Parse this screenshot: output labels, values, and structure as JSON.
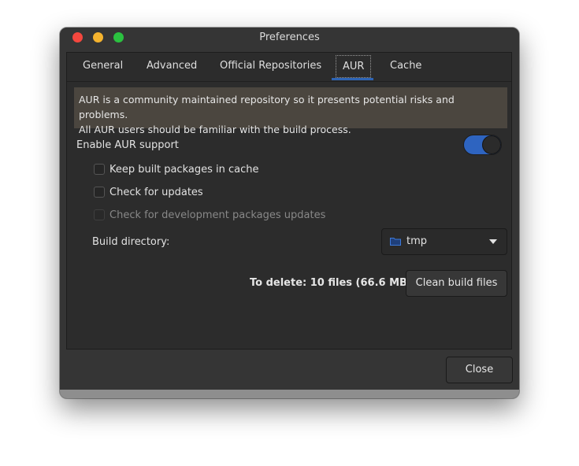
{
  "window": {
    "title": "Preferences"
  },
  "tabs": [
    {
      "label": "General"
    },
    {
      "label": "Advanced"
    },
    {
      "label": "Official Repositories"
    },
    {
      "label": "AUR"
    },
    {
      "label": "Cache"
    }
  ],
  "active_tab": "AUR",
  "notice": {
    "line1": "AUR is a community maintained repository so it presents potential risks and problems.",
    "line2": "All AUR users should be familiar with the build process."
  },
  "aur": {
    "enable_label": "Enable AUR support",
    "enabled": true,
    "checkboxes": [
      {
        "label": "Keep built packages in cache",
        "checked": false,
        "disabled": false
      },
      {
        "label": "Check for updates",
        "checked": false,
        "disabled": false
      },
      {
        "label": "Check for development packages updates",
        "checked": false,
        "disabled": true
      }
    ],
    "build_directory_label": "Build directory:",
    "build_directory_value": "tmp",
    "to_delete_text": "To delete:  10 files  (66.6 MB)",
    "clean_button": "Clean build files"
  },
  "footer": {
    "close_button": "Close"
  },
  "colors": {
    "accent": "#2e64c0",
    "notice_bg": "#4b463f",
    "window_bg": "#353535"
  },
  "icons": {
    "build_directory": "folder-icon",
    "dropdown": "chevron-down-icon"
  }
}
